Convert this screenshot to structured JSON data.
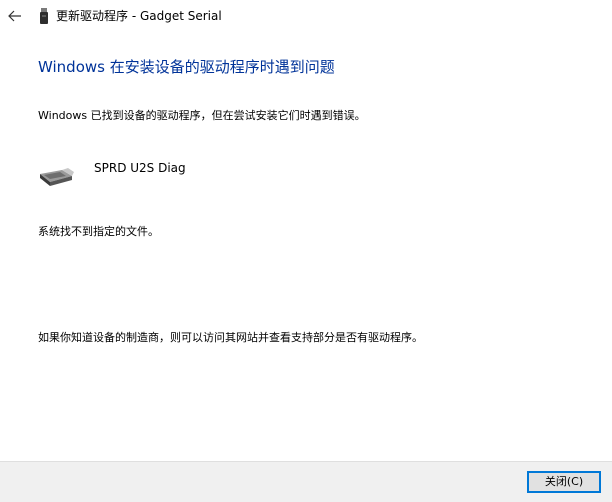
{
  "titlebar": {
    "back_icon": "back-arrow-icon",
    "device_icon": "usb-device-icon",
    "title": "更新驱动程序 - Gadget Serial"
  },
  "main": {
    "heading": "Windows 在安装设备的驱动程序时遇到问题",
    "description": "Windows 已找到设备的驱动程序，但在尝试安装它们时遇到错误。",
    "device": {
      "icon": "usb-device-icon",
      "name": "SPRD U2S Diag"
    },
    "error": "系统找不到指定的文件。",
    "hint": "如果你知道设备的制造商，则可以访问其网站并查看支持部分是否有驱动程序。"
  },
  "footer": {
    "close_label": "关闭(C)"
  },
  "colors": {
    "heading": "#003399",
    "footer_bg": "#f0f0f0",
    "button_border": "#0078d7",
    "button_bg": "#e1e1e1"
  }
}
